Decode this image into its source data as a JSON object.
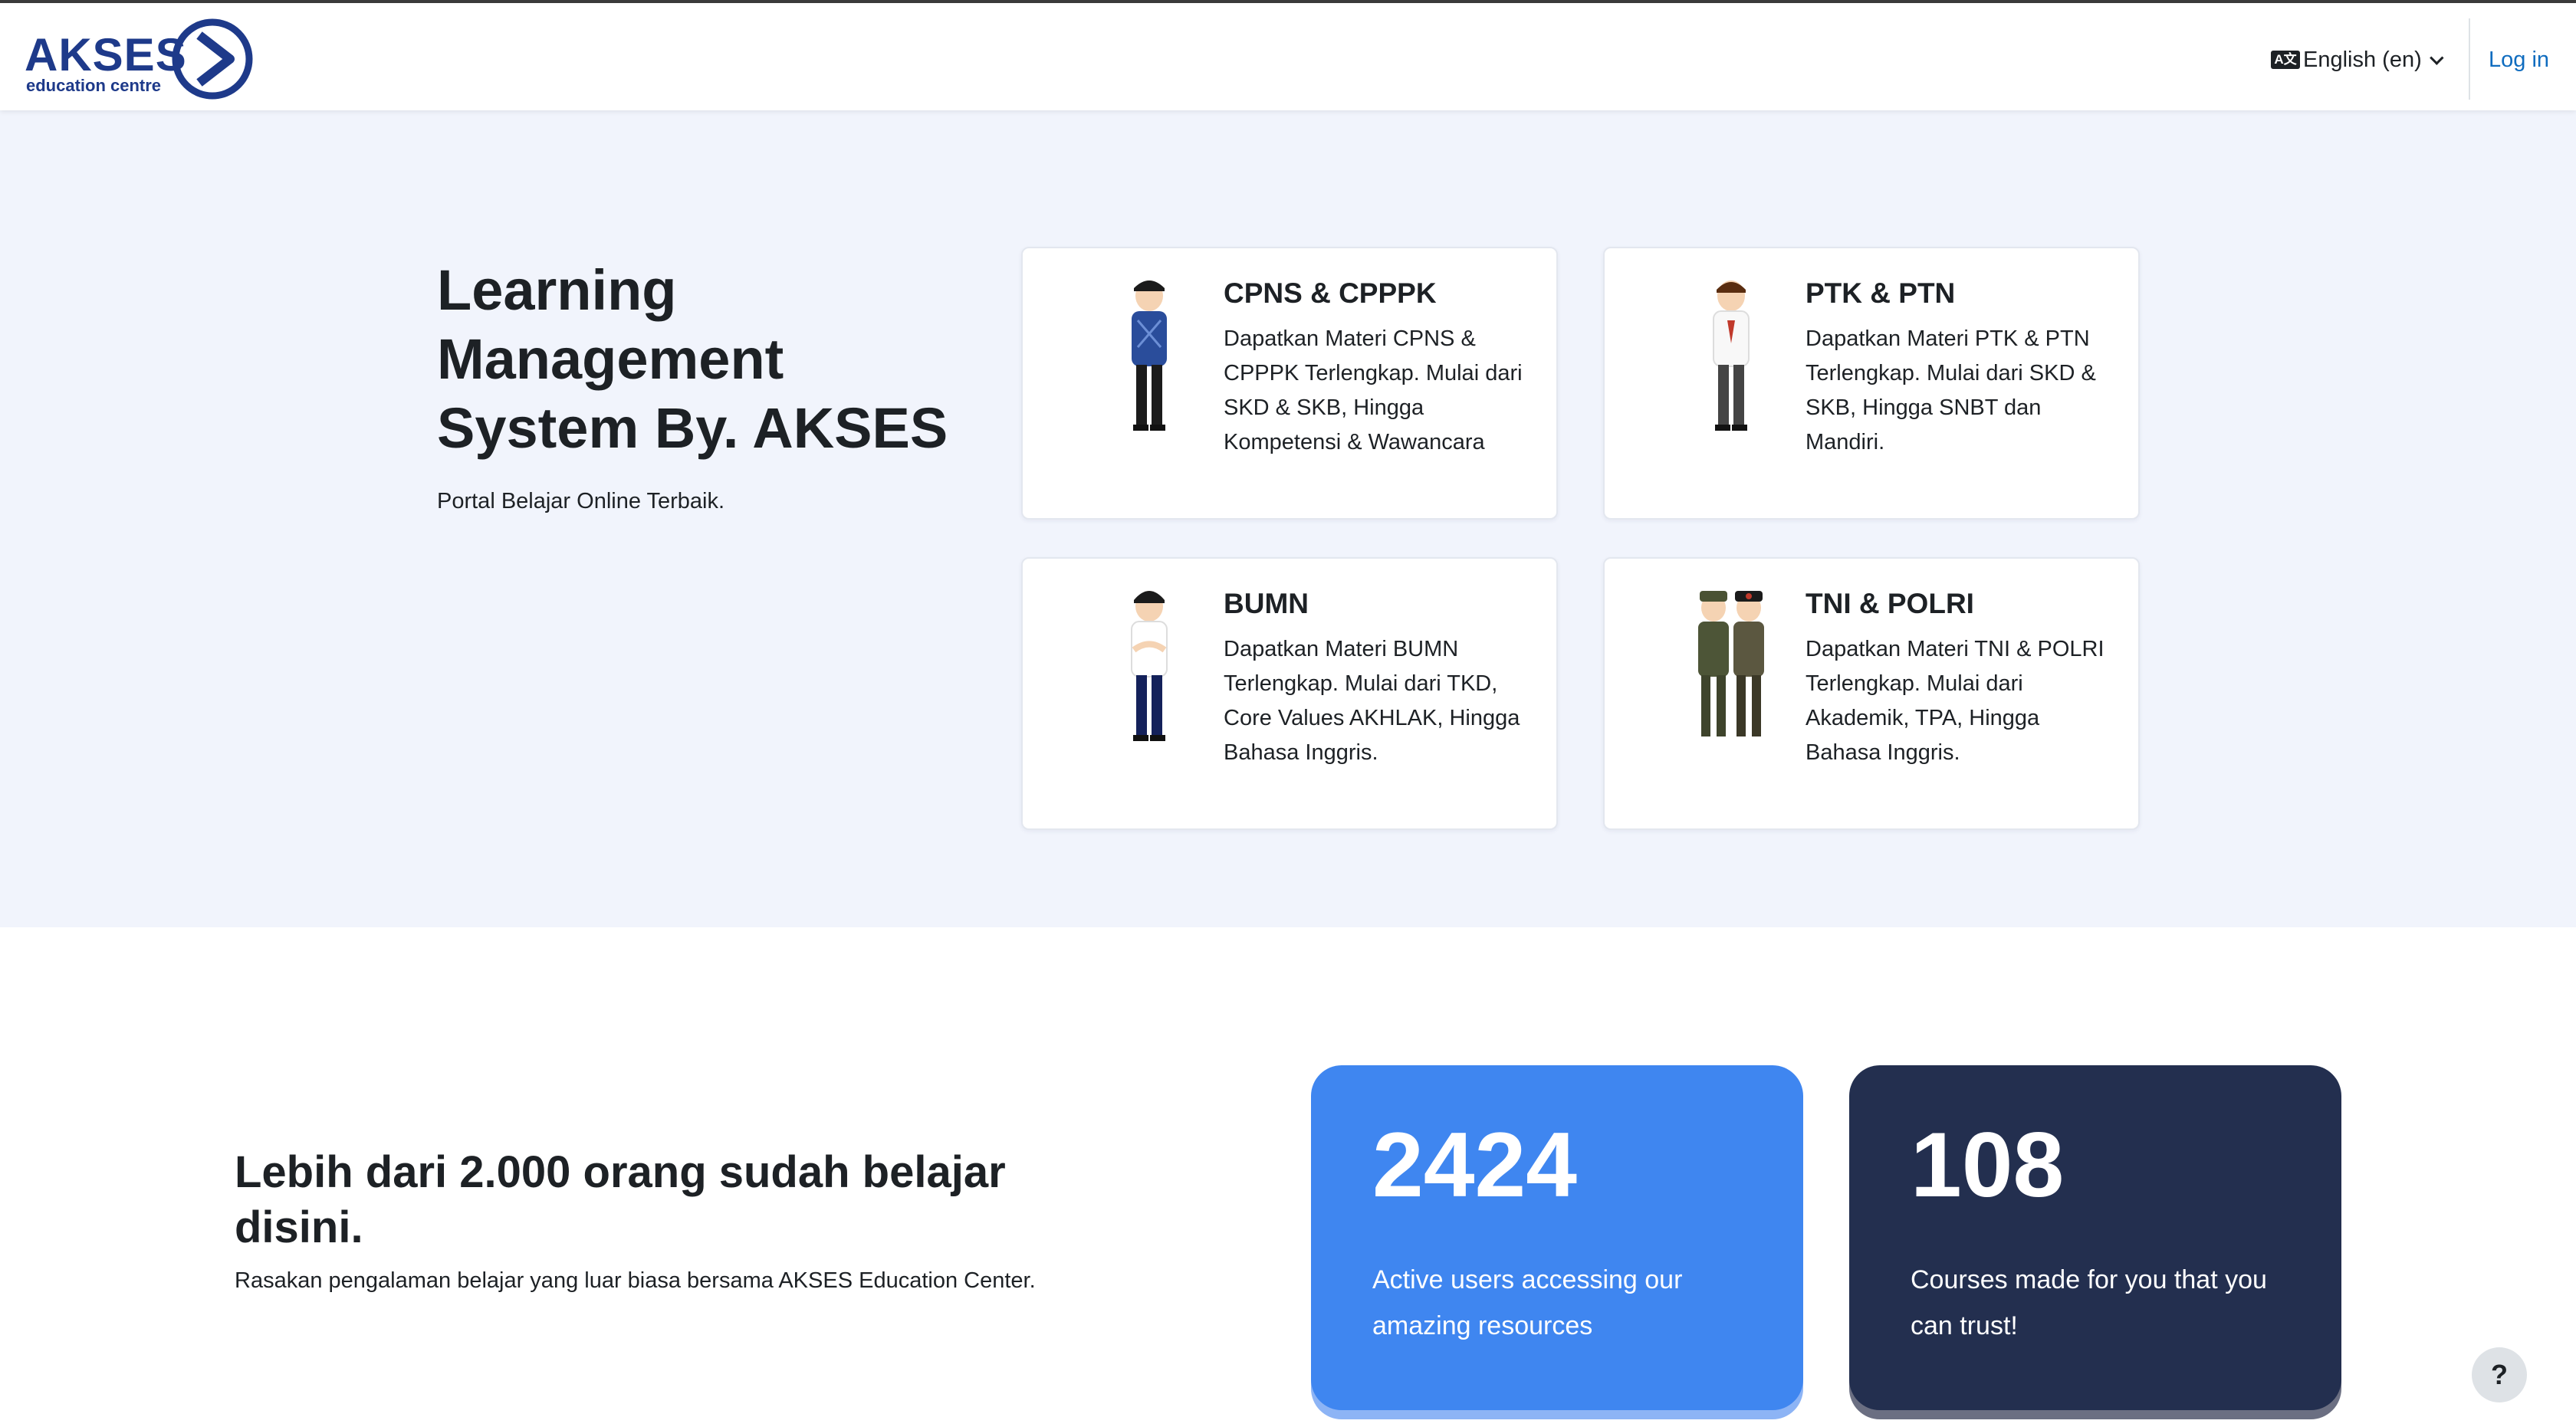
{
  "navbar": {
    "logo_main": "AKSES",
    "logo_sub": "education centre",
    "language": "English (en)",
    "language_icon_text": "A文",
    "login": "Log in"
  },
  "hero": {
    "title": "Learning Management System By. AKSES",
    "subtitle": "Portal Belajar Online Terbaik."
  },
  "cards": [
    {
      "title": "CPNS & CPPPK",
      "text": "Dapatkan Materi CPNS & CPPPK Terlengkap. Mulai dari SKD & SKB, Hingga Kompetensi & Wawancara",
      "icon": "civil-servant-figure"
    },
    {
      "title": "PTK & PTN",
      "text": "Dapatkan Materi PTK & PTN Terlengkap. Mulai dari SKD & SKB, Hingga SNBT dan Mandiri.",
      "icon": "student-figure"
    },
    {
      "title": "BUMN",
      "text": "Dapatkan Materi BUMN Terlengkap. Mulai dari TKD, Core Values AKHLAK, Hingga Bahasa Inggris.",
      "icon": "employee-figure"
    },
    {
      "title": "TNI & POLRI",
      "text": "Dapatkan Materi TNI & POLRI Terlengkap. Mulai dari Akademik, TPA, Hingga Bahasa Inggris.",
      "icon": "military-police-figures"
    }
  ],
  "section2": {
    "title": "Lebih dari 2.000 orang sudah belajar disini.",
    "subtitle": "Rasakan pengalaman belajar yang luar biasa bersama AKSES Education Center."
  },
  "stats": [
    {
      "number": "2424",
      "text": "Active users accessing our amazing resources",
      "color": "#3f86f0"
    },
    {
      "number": "108",
      "text": "Courses made for you that you can trust!",
      "color": "#232f4f"
    }
  ],
  "help": {
    "label": "?"
  },
  "colors": {
    "brand": "#1e3a8a",
    "link": "#0f6cbf",
    "hero_bg": "#f1f4fc"
  }
}
